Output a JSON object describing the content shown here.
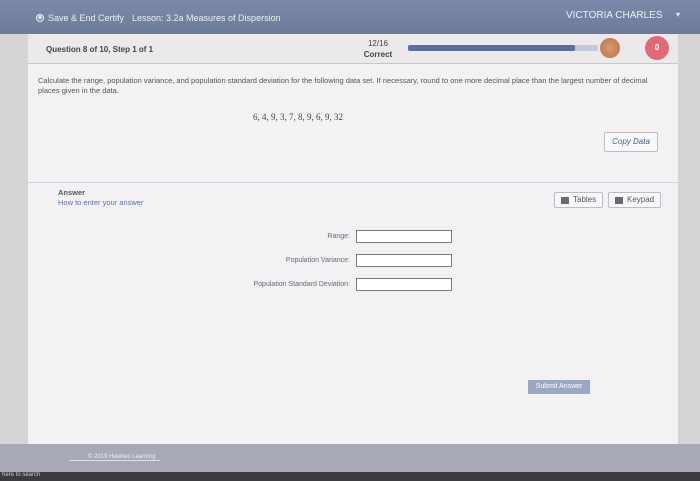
{
  "topbar": {
    "save_label": "Save & End Certify",
    "lesson": "Lesson: 3.2a Measures of Dispersion",
    "user": "VICTORIA CHARLES",
    "caret": "▾"
  },
  "question_bar": {
    "label": "Question 8 of 10, Step 1 of 1",
    "score": "12/16",
    "status": "Correct",
    "progress": 0.88,
    "hearts": "0"
  },
  "question": {
    "instructions": "Calculate the range, population variance, and population standard deviation for the following data set. If necessary, round to one more decimal place than the largest number of decimal places given in the data.",
    "dataset": "6, 4, 9, 3, 7, 8, 9, 6, 9, 32",
    "copy_data": "Copy Data"
  },
  "answer": {
    "title": "Answer",
    "howto": "How to enter your answer",
    "tables": "Tables",
    "keypad": "Keypad",
    "fields": [
      {
        "label": "Range:",
        "value": ""
      },
      {
        "label": "Population Variance:",
        "value": ""
      },
      {
        "label": "Population Standard Deviation:",
        "value": ""
      }
    ],
    "submit": "Submit Answer"
  },
  "footer": {
    "copyright": "© 2019 Hawkes Learning"
  },
  "taskbar": {
    "search": "here to search"
  }
}
